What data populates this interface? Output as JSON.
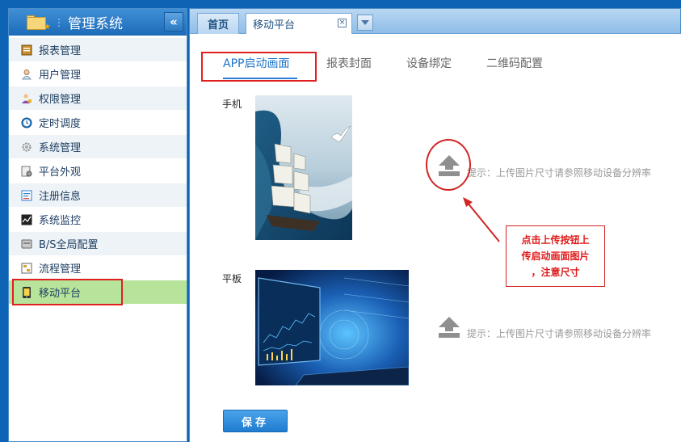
{
  "sidebar": {
    "title": "管理系统",
    "collapse_glyph": "«",
    "items": [
      {
        "label": "报表管理",
        "icon": "report-icon"
      },
      {
        "label": "用户管理",
        "icon": "user-icon"
      },
      {
        "label": "权限管理",
        "icon": "permission-icon"
      },
      {
        "label": "定时调度",
        "icon": "clock-icon"
      },
      {
        "label": "系统管理",
        "icon": "gear-icon"
      },
      {
        "label": "平台外观",
        "icon": "appearance-icon"
      },
      {
        "label": "注册信息",
        "icon": "register-icon"
      },
      {
        "label": "系统监控",
        "icon": "monitor-icon"
      },
      {
        "label": "B/S全局配置",
        "icon": "config-icon"
      },
      {
        "label": "流程管理",
        "icon": "flow-icon"
      },
      {
        "label": "移动平台",
        "icon": "mobile-icon",
        "active": true
      }
    ]
  },
  "tabs": {
    "home": "首页",
    "current": "移动平台",
    "close_glyph": "×"
  },
  "subtabs": [
    "APP启动画面",
    "报表封面",
    "设备绑定",
    "二维码配置"
  ],
  "sections": {
    "phone_label": "手机",
    "tablet_label": "平板",
    "hint": "提示：上传图片尺寸请参照移动设备分辨率"
  },
  "callout": {
    "line1": "点击上传按钮上",
    "line2": "传启动画面图片",
    "line3": "，注意尺寸"
  },
  "save_label": "保存",
  "colors": {
    "accent": "#1f74c9",
    "annotation_red": "#d32424",
    "active_menu": "#b8e39a"
  }
}
